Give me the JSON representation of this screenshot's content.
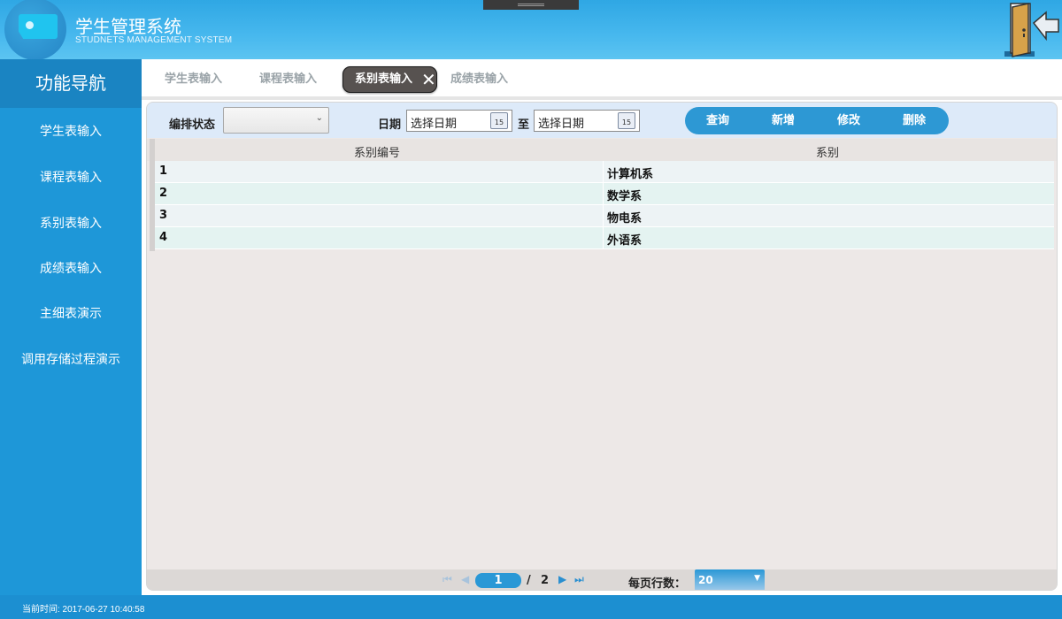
{
  "header": {
    "title": "学生管理系统",
    "subtitle": "STUDNETS MANAGEMENT SYSTEM",
    "exit_icon": "exit-door-icon"
  },
  "sidebar": {
    "title": "功能导航",
    "items": [
      {
        "label": "学生表输入"
      },
      {
        "label": "课程表输入"
      },
      {
        "label": "系别表输入"
      },
      {
        "label": "成绩表输入"
      },
      {
        "label": "主细表演示"
      },
      {
        "label": "调用存储过程演示"
      }
    ]
  },
  "tabs": [
    {
      "label": "学生表输入",
      "active": false
    },
    {
      "label": "课程表输入",
      "active": false
    },
    {
      "label": "系别表输入",
      "active": true
    },
    {
      "label": "成绩表输入",
      "active": false
    }
  ],
  "toolbar": {
    "status_label": "编排状态",
    "status_value": "",
    "date_label": "日期",
    "date_from": "选择日期",
    "to_label": "至",
    "date_to": "选择日期",
    "calendar_day": "15",
    "buttons": {
      "query": "查询",
      "add": "新增",
      "edit": "修改",
      "delete": "删除"
    }
  },
  "grid": {
    "columns": [
      "系别编号",
      "系别"
    ],
    "rows": [
      [
        "1",
        "计算机系"
      ],
      [
        "2",
        "数学系"
      ],
      [
        "3",
        "物电系"
      ],
      [
        "4",
        "外语系"
      ]
    ]
  },
  "pager": {
    "current_page": "1",
    "separator": "/",
    "total_pages": "2",
    "rows_label": "每页行数：",
    "rows_per_page": "20"
  },
  "footer": {
    "time_text": "当前时间: 2017-06-27 10:40:58"
  },
  "colors": {
    "header_blue": "#2fa7e4",
    "sidebar_blue": "#1e97d8",
    "active_tab": "#575250",
    "button_blue": "#2d98d4"
  }
}
